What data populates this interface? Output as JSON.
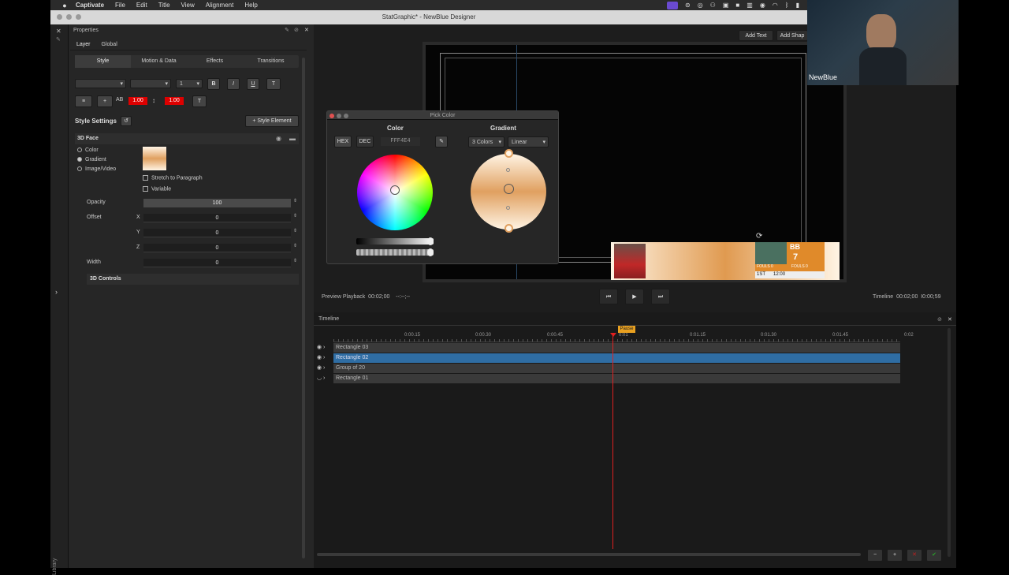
{
  "menubar": {
    "app": "Captivate",
    "items": [
      "File",
      "Edit",
      "Title",
      "View",
      "Alignment",
      "Help"
    ]
  },
  "window": {
    "title": "StatGraphic* - NewBlue Designer"
  },
  "properties": {
    "panel_title": "Properties",
    "tabs": [
      "Layer",
      "Global"
    ],
    "subtabs": [
      "Style",
      "Motion & Data",
      "Effects",
      "Transitions"
    ],
    "font_size": "1",
    "fmt": {
      "bold": "B",
      "italic": "I",
      "underline": "U",
      "tt": "T"
    },
    "spacing1": "1.00",
    "spacing2": "1.00",
    "style_settings": "Style Settings",
    "style_element": "+ Style Element",
    "face": "3D Face",
    "fill_options": [
      "Color",
      "Gradient",
      "Image/Video"
    ],
    "stretch": "Stretch to Paragraph",
    "variable": "Variable",
    "opacity_label": "Opacity",
    "opacity": "100",
    "offset_label": "Offset",
    "axes": [
      "X",
      "Y",
      "Z"
    ],
    "offset_values": [
      "0",
      "0",
      "0"
    ],
    "width_label": "Width",
    "width": "0",
    "controls3d": "3D Controls",
    "library": "Library"
  },
  "canvas": {
    "add_text": "Add Text",
    "add_shape": "Add Shap"
  },
  "scorebug": {
    "team": "BB",
    "score": "7",
    "fouls1": "FOULS 0",
    "fouls2": "FOULS 0",
    "period": "1ST",
    "clock": "12:00"
  },
  "pick_color": {
    "title": "Pick Color",
    "color_heading": "Color",
    "gradient_heading": "Gradient",
    "hex": "HEX",
    "dec": "DEC",
    "hex_value": "FFF4E4",
    "colors_option": "3 Colors",
    "type_option": "Linear"
  },
  "transport": {
    "preview_label": "Preview Playback",
    "preview_time": "00:02;00",
    "preview_dashes": "--:--;--",
    "timeline_label": "Timeline",
    "timeline_time": "00:02;00",
    "timeline_total": "I0:00;59"
  },
  "timeline": {
    "title": "Timeline",
    "marker": "Pause",
    "ticks": [
      "0:00.15",
      "0:00.30",
      "0:00.45",
      "0:01",
      "0:01.15",
      "0:01.30",
      "0:01.45",
      "0:02"
    ],
    "tracks": [
      "Rectangle 03",
      "Rectangle 02",
      "Group of 20",
      "Rectangle 01"
    ],
    "buttons": {
      "minus": "−",
      "plus": "+",
      "x": "✕",
      "check": "✔"
    }
  },
  "webcam": {
    "label": "NewBlue"
  },
  "colors": {
    "accent": "#2f6da3",
    "pause": "#e8a020",
    "playhead": "#e02020",
    "ok": "#2aa02a",
    "cancel": "#c02020"
  }
}
